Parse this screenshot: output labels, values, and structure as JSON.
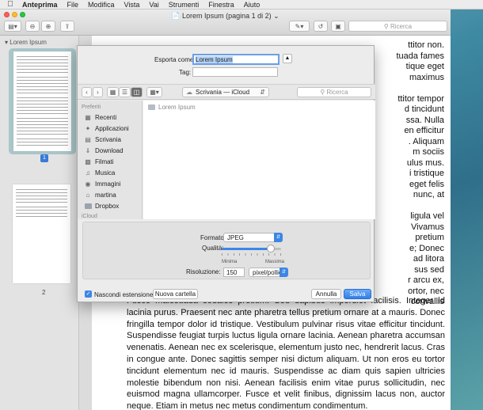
{
  "menubar": {
    "app": "Anteprima",
    "items": [
      "File",
      "Modifica",
      "Vista",
      "Vai",
      "Strumenti",
      "Finestra",
      "Aiuto"
    ]
  },
  "window": {
    "title": "Lorem Ipsum (pagina 1 di 2)",
    "search_placeholder": "Ricerca"
  },
  "sidebar": {
    "title": "Lorem Ipsum",
    "pages": [
      "1",
      "2"
    ],
    "selected_page": "1"
  },
  "document": {
    "right_lines": [
      "ttitor non.",
      "tuada fames",
      "tique eget",
      "maximus",
      "",
      "ttitor tempor",
      "d tincidunt",
      "ssa. Nulla",
      "en efficitur",
      ". Aliquam",
      "m sociis",
      "ulus mus.",
      "i tristique",
      "eget felis",
      "nunc, at",
      "",
      "ligula vel",
      "Vivamus",
      "pretium",
      "e; Donec",
      "ad litora",
      "sus sed",
      "r arcu ex,",
      "ortor, nec",
      "convallis"
    ],
    "bottom_text": "Fusce malesuada sodales pretium. Sed dapibus imperdiet facilisis. Integer id lacinia purus. Praesent nec ante pharetra tellus pretium ornare at a mauris. Donec fringilla tempor dolor id tristique. Vestibulum pulvinar risus vitae efficitur tincidunt. Suspendisse feugiat turpis luctus ligula ornare lacinia. Aenean pharetra accumsan venenatis. Aenean nec ex scelerisque, elementum justo nec, hendrerit lacus. Cras in congue ante. Donec sagittis semper nisi dictum aliquam. Ut non eros eu tortor tincidunt elementum nec id mauris. Suspendisse ac diam quis sapien ultricies molestie bibendum non nisi. Aenean facilisis enim vitae purus sollicitudin, nec euismod magna ullamcorper. Fusce et velit finibus, dignissim lacus non, auctor neque. Etiam in metus nec metus condimentum condimentum."
  },
  "export_sheet": {
    "export_as_label": "Esporta come:",
    "export_name": "Lorem Ipsum",
    "tag_label": "Tag:",
    "location": "Scrivania — iCloud",
    "search_placeholder": "Ricerca",
    "favorites_header": "Preferiti",
    "icloud_header": "iCloud",
    "favorites": [
      {
        "label": "Recenti",
        "icon": "clock-icon"
      },
      {
        "label": "Applicazioni",
        "icon": "applications-icon"
      },
      {
        "label": "Scrivania",
        "icon": "desktop-icon"
      },
      {
        "label": "Download",
        "icon": "download-icon"
      },
      {
        "label": "Filmati",
        "icon": "movies-icon"
      },
      {
        "label": "Musica",
        "icon": "music-icon"
      },
      {
        "label": "Immagini",
        "icon": "pictures-icon"
      },
      {
        "label": "martina",
        "icon": "home-icon"
      },
      {
        "label": "Dropbox",
        "icon": "dropbox-icon"
      }
    ],
    "file_item": "Lorem Ipsum",
    "format_label": "Formato:",
    "format_value": "JPEG",
    "quality_label": "Qualità:",
    "quality_level": 0.82,
    "quality_min": "Minima",
    "quality_max": "Massima",
    "resolution_label": "Risoluzione:",
    "resolution_value": "150",
    "resolution_unit": "pixel/pollici",
    "hide_extension_label": "Nascondi estensione",
    "hide_extension_checked": true,
    "new_folder_button": "Nuova cartella",
    "cancel_button": "Annulla",
    "save_button": "Salva"
  }
}
